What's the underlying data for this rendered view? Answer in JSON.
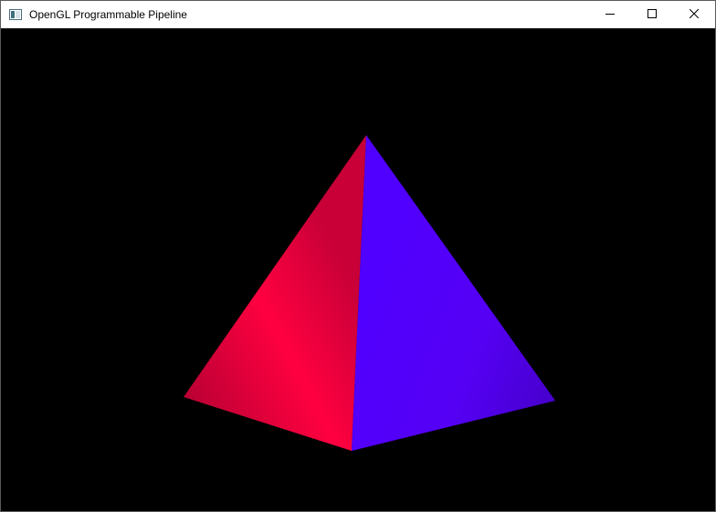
{
  "window": {
    "title": "OpenGL Programmable Pipeline",
    "icon": "app-window-icon",
    "controls": {
      "minimize_icon": "minimize-icon",
      "maximize_icon": "maximize-icon",
      "close_icon": "close-icon"
    }
  },
  "scene": {
    "background_color": "#000000",
    "object": "pyramid",
    "faces": [
      {
        "name": "left-face",
        "color_light": "#ff0040",
        "color_dark": "#b80033"
      },
      {
        "name": "right-face",
        "color_light": "#5a00ff",
        "color_dark": "#4a00c8"
      }
    ]
  }
}
